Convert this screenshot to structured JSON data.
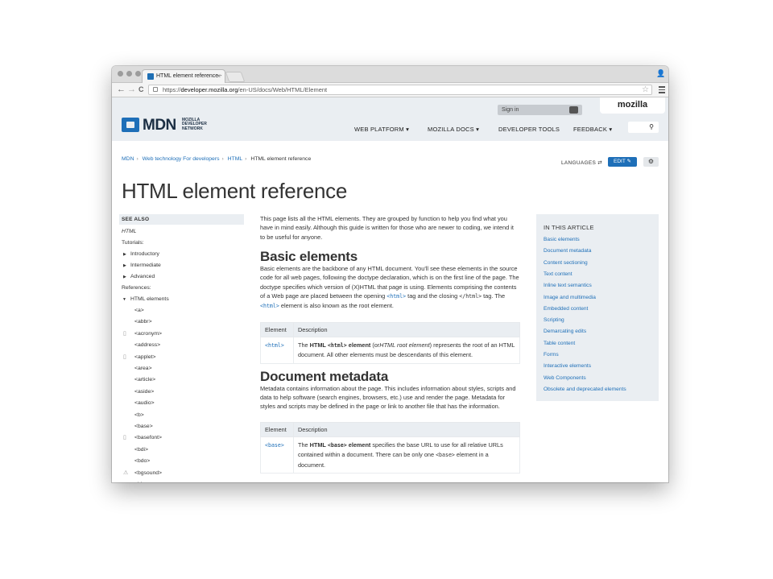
{
  "browser": {
    "tab_title": "HTML element reference -",
    "tab_close": "×",
    "url_prefix": "https://",
    "url_domain": "developer.mozilla.org",
    "url_path": "/en-US/docs/Web/HTML/Element",
    "back": "←",
    "forward": "→",
    "reload": "C",
    "star": "☆"
  },
  "header": {
    "logo_word": "MDN",
    "logo_sub": "MOZILLA DEVELOPER NETWORK",
    "signin": "Sign in",
    "mozilla": "mozilla",
    "nav": [
      "WEB PLATFORM",
      "MOZILLA DOCS",
      "DEVELOPER TOOLS",
      "FEEDBACK"
    ],
    "search_icon": "search-icon"
  },
  "breadcrumbs": [
    "MDN",
    "Web technology For developers",
    "HTML",
    "HTML element reference"
  ],
  "toolbar": {
    "languages": "LANGUAGES",
    "edit": "EDIT",
    "gear_icon": "gear-icon"
  },
  "page_title": "HTML element reference",
  "sidebar": {
    "see_also": "SEE ALSO",
    "html": "HTML",
    "tutorials": "Tutorials:",
    "tutorial_items": [
      "Introductory",
      "Intermediate",
      "Advanced"
    ],
    "references": "References:",
    "html_elements": "HTML elements",
    "elements": [
      "<a>",
      "<abbr>",
      "<acronym>",
      "<address>",
      "<applet>",
      "<area>",
      "<article>",
      "<aside>",
      "<audio>",
      "<b>",
      "<base>",
      "<basefont>",
      "<bdi>",
      "<bdo>",
      "<bgsound>",
      "<big>"
    ]
  },
  "intro": "This page lists all the HTML elements. They are grouped by function to help you find what you have in mind easily. Although this guide is written for those who are newer to coding, we intend it to be useful for anyone.",
  "basic": {
    "heading": "Basic elements",
    "p1": "Basic elements are the backbone of any HTML document. You'll see these elements in the source code for all web pages, following the doctype declaration, which is on the first line of the page. The doctype specifies which version of (X)HTML that page is using. Elements comprising the contents of a Web page are placed between the opening",
    "code1": "<html>",
    "p2": "tag and the closing",
    "code2": "</html>",
    "p3": "tag. The",
    "code3": "<html>",
    "p4": "element is also known as the root element.",
    "col1": "Element",
    "col2": "Description",
    "row_el": "<html>",
    "d1": "The",
    "d_strong": "HTML",
    "d_code": "<html>",
    "d_strong2": "element",
    "d2": "(or",
    "d_em": "HTML root element",
    "d3": ") represents the root of an HTML document. All other elements must be descendants of this element."
  },
  "meta": {
    "heading": "Document metadata",
    "p": "Metadata contains information about the page. This includes information about styles, scripts and data to help software (search engines, browsers, etc.) use and render the page. Metadata for styles and scripts may be defined in the page or link to another file that has the information.",
    "col1": "Element",
    "col2": "Description",
    "row_el": "<base>",
    "d1": "The",
    "d_strong": "HTML",
    "d_code": "<base>",
    "d_strong2": "element",
    "d2": "specifies the base URL to use for all relative URLs contained within a document. There can be only one",
    "d_code2": "<base>",
    "d3": "element in a document."
  },
  "toc": {
    "heading": "IN THIS ARTICLE",
    "items": [
      "Basic elements",
      "Document metadata",
      "Content sectioning",
      "Text content",
      "Inline text semantics",
      "Image and multimedia",
      "Embedded content",
      "Scripting",
      "Demarcating edits",
      "Table content",
      "Forms",
      "Interactive elements",
      "Web Components",
      "Obsolete and deprecated elements"
    ]
  }
}
